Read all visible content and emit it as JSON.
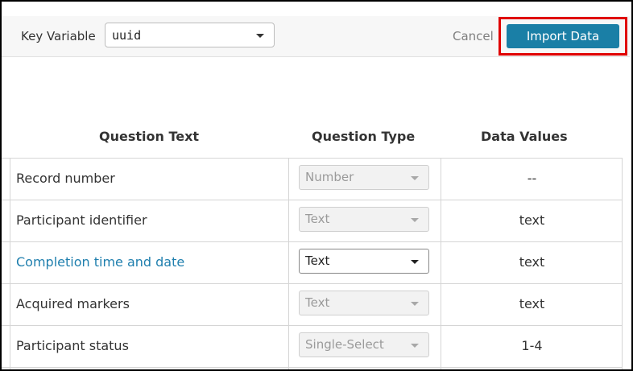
{
  "toolbar": {
    "key_variable_label": "Key Variable",
    "key_variable_value": "uuid",
    "cancel_label": "Cancel",
    "import_label": "Import Data"
  },
  "table": {
    "headers": {
      "question_text": "Question Text",
      "question_type": "Question Type",
      "data_values": "Data Values"
    },
    "rows": [
      {
        "question": "Record number",
        "type": "Number",
        "values": "--"
      },
      {
        "question": "Participant identifier",
        "type": "Text",
        "values": "text"
      },
      {
        "question": "Completion time and date",
        "type": "Text",
        "values": "text"
      },
      {
        "question": "Acquired markers",
        "type": "Text",
        "values": "text"
      },
      {
        "question": "Participant status",
        "type": "Single-Select",
        "values": "1-4"
      }
    ]
  },
  "colors": {
    "accent": "#1a7fa6",
    "highlight_border": "#e00000",
    "link": "#1f7fae"
  }
}
